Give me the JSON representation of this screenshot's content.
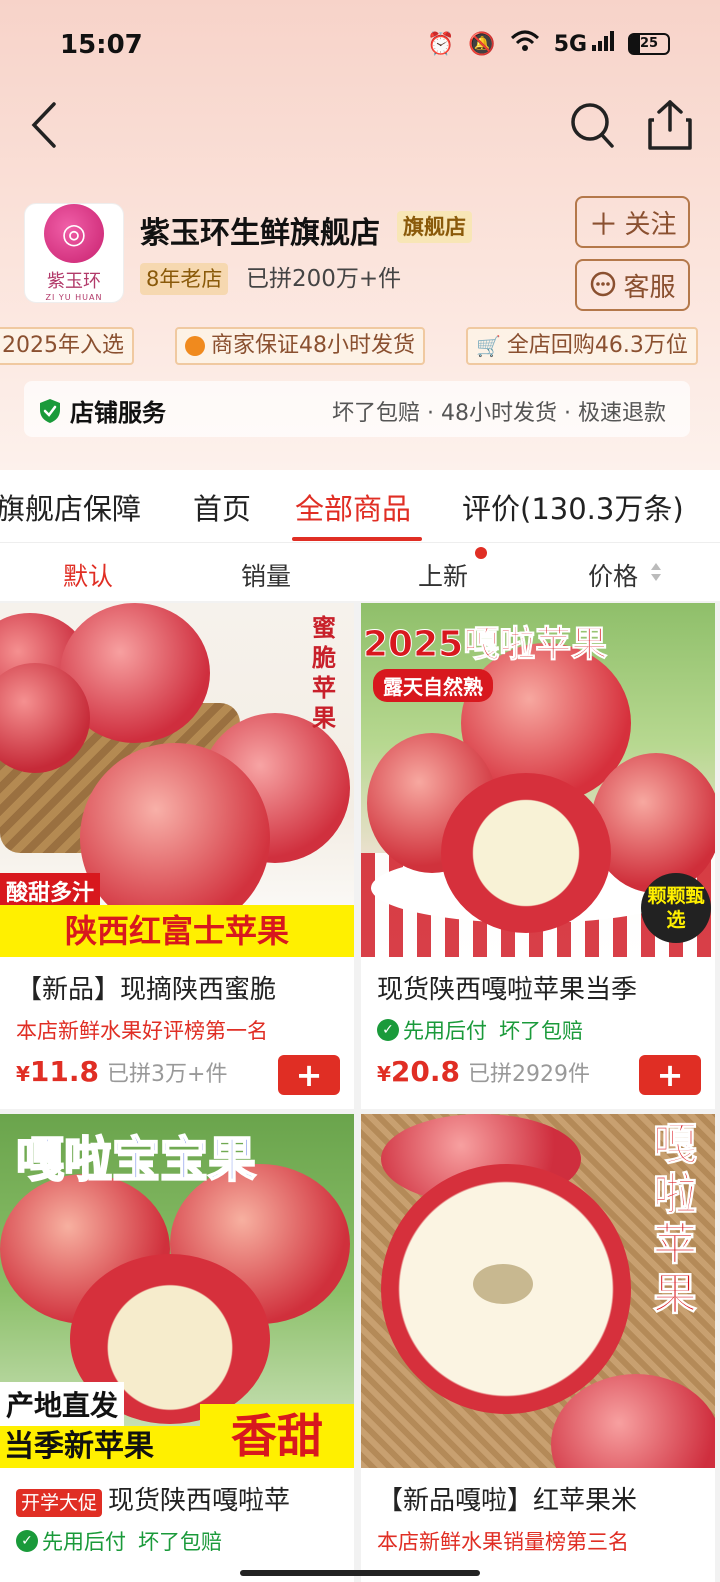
{
  "status": {
    "time": "15:07",
    "battery": "25",
    "network": "5G"
  },
  "shop": {
    "logo_text": "紫玉环",
    "logo_sub": "ZI YU HUAN",
    "name": "紫玉环生鲜旗舰店",
    "flag_badge": "旗舰店",
    "age_badge": "8年老店",
    "sales": "已拼200万+件",
    "follow_label": "关注",
    "service_label": "客服"
  },
  "tags": [
    "2025年入选",
    "商家保证48小时发货",
    "全店回购46.3万位"
  ],
  "store_service": {
    "title": "店铺服务",
    "desc": "坏了包赔 · 48小时发货 · 极速退款"
  },
  "tabs": [
    "旗舰店保障",
    "首页",
    "全部商品",
    "评价(130.3万条)"
  ],
  "active_tab": "全部商品",
  "sort": [
    "默认",
    "销量",
    "上新",
    "价格"
  ],
  "active_sort": "默认",
  "products": [
    {
      "img_vertical_text": "蜜脆苹果",
      "img_tag": "酸甜多汁",
      "img_banner": "陕西红富士苹果",
      "title": "【新品】现摘陕西蜜脆",
      "subtitle": "本店新鲜水果好评榜第一名",
      "currency": "¥",
      "price": "11.8",
      "sold": "已拼3万+件"
    },
    {
      "img_headline": "2025嘎啦苹果",
      "img_sub": "露天自然熟",
      "img_corner": "颗颗甄选",
      "title": "现货陕西嘎啦苹果当季",
      "subtitle_a": "先用后付",
      "subtitle_b": "坏了包赔",
      "currency": "¥",
      "price": "20.8",
      "sold": "已拼2929件"
    },
    {
      "img_headline": "嘎啦宝宝果",
      "img_tag": "产地直发",
      "img_banner_a": "当季新苹果",
      "img_banner_b": "香甜",
      "promo": "开学大促",
      "title": "现货陕西嘎啦苹",
      "subtitle_a": "先用后付",
      "subtitle_b": "坏了包赔"
    },
    {
      "img_vertical_text": "嘎啦苹果",
      "title": "【新品嘎啦】红苹果米",
      "subtitle": "本店新鲜水果销量榜第三名"
    }
  ]
}
